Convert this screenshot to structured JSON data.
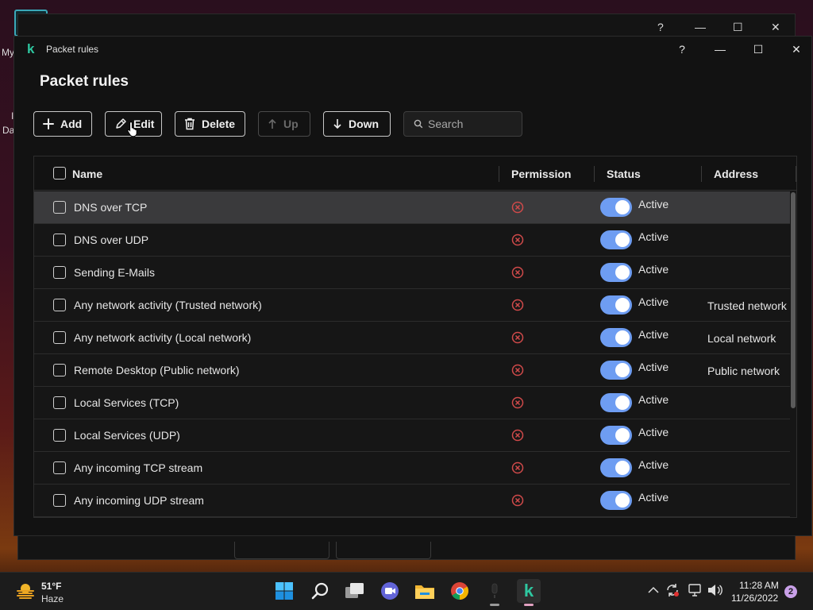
{
  "desktop": {
    "labels": [
      "My",
      "I",
      "Da"
    ]
  },
  "background_window": {
    "help": "?",
    "minimize": "—",
    "maximize": "☐",
    "close": "✕"
  },
  "window": {
    "title": "Packet rules",
    "help": "?",
    "minimize": "—",
    "maximize": "☐",
    "close": "✕"
  },
  "page": {
    "title": "Packet rules"
  },
  "toolbar": {
    "add_label": "Add",
    "edit_label": "Edit",
    "delete_label": "Delete",
    "up_label": "Up",
    "down_label": "Down",
    "search_placeholder": "Search"
  },
  "table": {
    "columns": [
      "Name",
      "Permission",
      "Status",
      "Address"
    ],
    "rows": [
      {
        "name": "DNS over TCP",
        "status": "Active",
        "address": ""
      },
      {
        "name": "DNS over UDP",
        "status": "Active",
        "address": ""
      },
      {
        "name": "Sending E-Mails",
        "status": "Active",
        "address": ""
      },
      {
        "name": "Any network activity (Trusted network)",
        "status": "Active",
        "address": "Trusted network"
      },
      {
        "name": "Any network activity (Local network)",
        "status": "Active",
        "address": "Local network"
      },
      {
        "name": "Remote Desktop (Public network)",
        "status": "Active",
        "address": "Public network"
      },
      {
        "name": "Local Services (TCP)",
        "status": "Active",
        "address": ""
      },
      {
        "name": "Local Services (UDP)",
        "status": "Active",
        "address": ""
      },
      {
        "name": "Any incoming TCP stream",
        "status": "Active",
        "address": ""
      },
      {
        "name": "Any incoming UDP stream",
        "status": "Active",
        "address": ""
      }
    ]
  },
  "colors": {
    "toggle_on": "#6e9df2",
    "deny_icon": "#d04a4a",
    "app_accent": "#2ec7a0"
  },
  "taskbar": {
    "weather_temp": "51°F",
    "weather_desc": "Haze",
    "time": "11:28 AM",
    "date": "11/26/2022",
    "notifications": "2"
  }
}
